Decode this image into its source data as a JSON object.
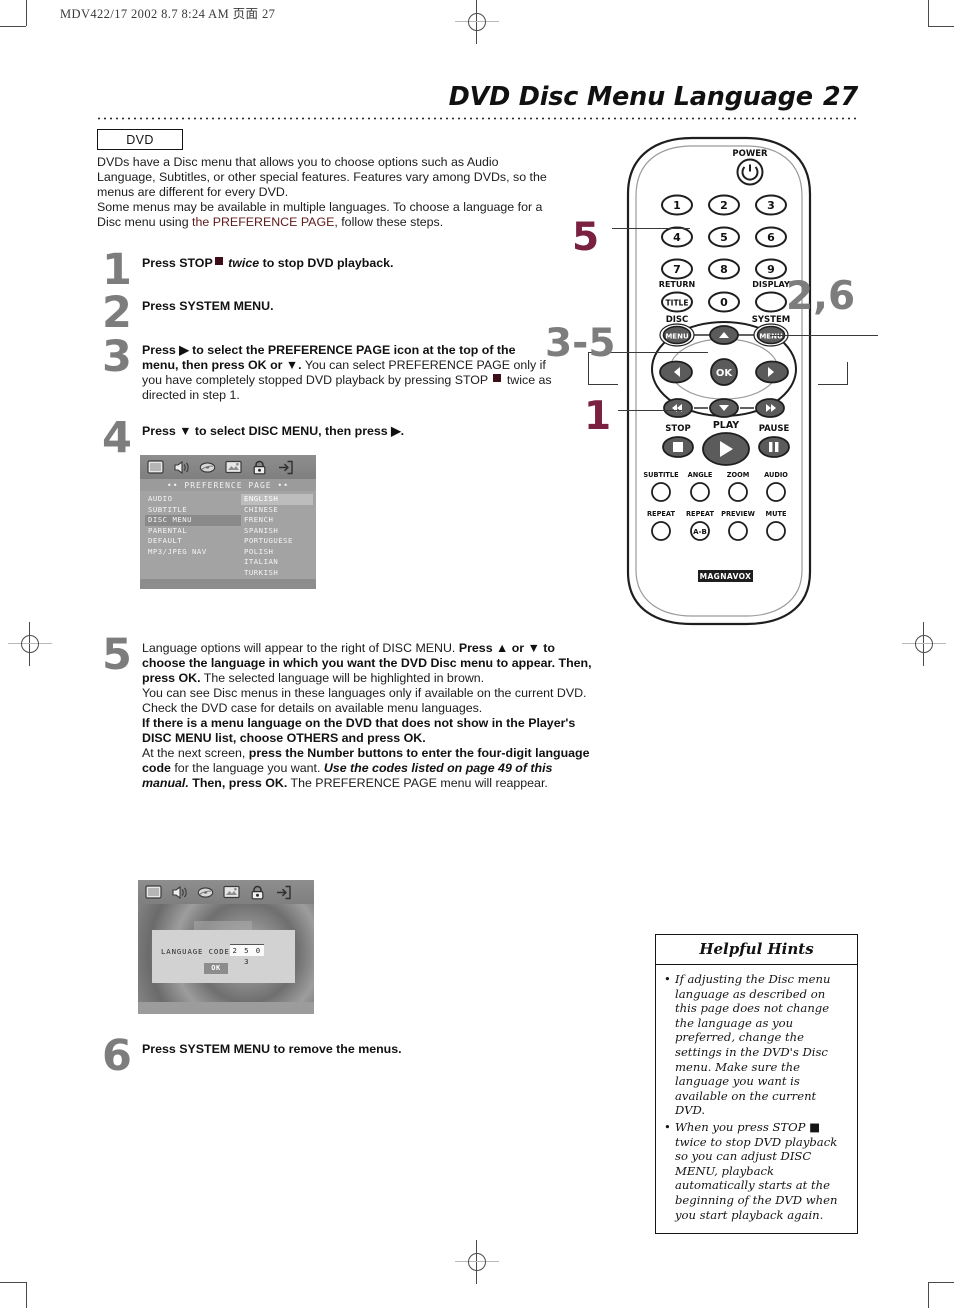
{
  "slug": "MDV422/17   2002 8.7   8:24 AM   页面 27",
  "title": {
    "text": "DVD Disc Menu Language",
    "page": "27"
  },
  "badge": {
    "label": "DVD"
  },
  "intro": {
    "p1_a": "DVDs have a Disc menu that allows you to choose options such as Audio Language, Subtitles, or other special features. Features vary among DVDs, so the menus are different for every DVD.",
    "p2_a": "Some menus may be available in multiple languages. To choose a language for a Disc menu using ",
    "p2_red": "the PREFERENCE PAGE",
    "p2_b": ", follow these steps."
  },
  "steps": [
    {
      "num": "1",
      "bold_a": "Press STOP",
      "italic_b": "twice",
      "bold_c": "to stop DVD playback."
    },
    {
      "num": "2",
      "bold_a": "Press SYSTEM MENU."
    },
    {
      "num": "3",
      "bold_a": "Press ▶ to select the PREFERENCE PAGE icon at the top of the menu, then press OK or ▼.",
      "plain_b": " You can select PREFERENCE PAGE only if you have completely stopped DVD playback by pressing STOP ",
      "plain_c": " twice as directed in step 1."
    },
    {
      "num": "4",
      "bold_a": "Press ▼ to select DISC MENU, then press ▶."
    },
    {
      "num": "5",
      "plain_a": "Language options will appear to the right of DISC MENU. ",
      "bold_b": "Press ▲ or ▼ to choose the language in which you want the DVD Disc menu to appear. Then, press OK.",
      "plain_c": " The selected language will be highlighted in brown.",
      "plain_d": "You can see Disc menus in these languages only if available on the current DVD. Check the DVD case for details on available menu languages.",
      "bold_e": "If there is a menu language on the DVD that does not show in the Player's DISC MENU list, choose OTHERS and press OK.",
      "plain_f": "At the next screen, ",
      "bold_g": "press the Number buttons to enter the four-digit language code",
      "plain_h": " for the language you want. ",
      "bolditalic_i": "Use the codes listed on page 49 of this manual.",
      "bold_j": " Then, press OK.",
      "plain_k": " The PREFERENCE PAGE menu will reappear."
    },
    {
      "num": "6",
      "bold_a": "Press SYSTEM MENU to remove the menus."
    }
  ],
  "tv_preference": {
    "icons": [
      "tv-screen-icon",
      "speaker-audio-icon",
      "disc-icon",
      "video-preference-icon",
      "lock-parental-icon",
      "exit-icon"
    ],
    "page_title": "••  PREFERENCE  PAGE  ••",
    "menu_items": [
      "AUDIO",
      "SUBTITLE",
      "DISC MENU",
      "PARENTAL",
      "DEFAULT",
      "MP3/JPEG NAV"
    ],
    "selected_item": "DISC MENU",
    "languages": [
      "ENGLISH",
      "CHINESE",
      "FRENCH",
      "SPANISH",
      "PORTUGUESE",
      "POLISH",
      "ITALIAN",
      "TURKISH"
    ],
    "highlighted_language": "ENGLISH"
  },
  "tv_language_code": {
    "label": "LANGUAGE CODE",
    "code": "2 5 0 3",
    "ok_label": "OK"
  },
  "remote": {
    "power_label": "POWER",
    "number_keys": [
      "1",
      "2",
      "3",
      "4",
      "5",
      "6",
      "7",
      "8",
      "9",
      "0"
    ],
    "return_label": "RETURN",
    "title_label": "TITLE",
    "display_label": "DISPLAY",
    "disc_label": "DISC",
    "disc_menu_label": "MENU",
    "system_label": "SYSTEM",
    "system_menu_label": "MENU",
    "ok_label": "OK",
    "stop_label": "STOP",
    "play_label": "PLAY",
    "pause_label": "PAUSE",
    "feature_row1": [
      "SUBTITLE",
      "ANGLE",
      "ZOOM",
      "AUDIO"
    ],
    "feature_row2": [
      "REPEAT",
      "REPEAT",
      "PREVIEW",
      "MUTE"
    ],
    "repeat_ab_label": "A-B",
    "brand": "MAGNAVOX",
    "callouts": [
      {
        "label": "5",
        "color": "#7a2040"
      },
      {
        "label": "2,6",
        "color": "#7d7d7d"
      },
      {
        "label": "3-5",
        "color": "#7d7d7d"
      },
      {
        "label": "1",
        "color": "#7a2040"
      }
    ]
  },
  "hints": {
    "heading": "Helpful Hints",
    "items": [
      "If adjusting the Disc menu language as described on this page does not change the language as you preferred, change the settings in the DVD's Disc menu. Make sure the language you want is available on the current DVD.",
      "When you press STOP ■ twice to stop DVD playback so you can adjust DISC MENU, playback automatically starts at the beginning of the DVD when you start playback again."
    ]
  },
  "colors": {
    "accent_maroon": "#7a2040",
    "step_gray": "#7d7d7d",
    "pref_red": "#5c1a1a"
  }
}
